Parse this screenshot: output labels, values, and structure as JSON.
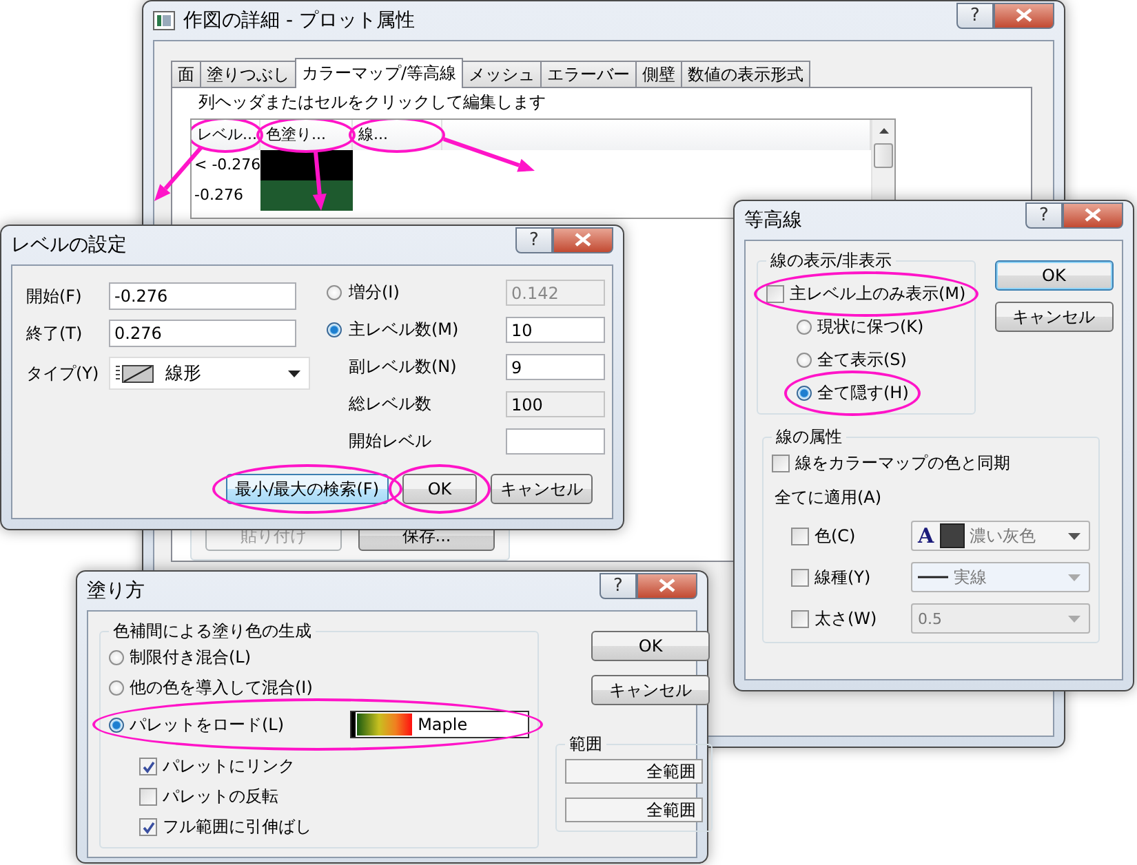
{
  "main_window": {
    "title": "作図の詳細 - プロット属性",
    "help": "?",
    "tabs": [
      {
        "label": "面",
        "selected": false
      },
      {
        "label": "塗りつぶし",
        "selected": false
      },
      {
        "label": "カラーマップ/等高線",
        "selected": true
      },
      {
        "label": "メッシュ",
        "selected": false
      },
      {
        "label": "エラーバー",
        "selected": false
      },
      {
        "label": "側壁",
        "selected": false
      },
      {
        "label": "数値の表示形式",
        "selected": false
      }
    ],
    "hint": "列ヘッダまたはセルをクリックして編集します",
    "grid": {
      "columns": [
        "レベル...",
        "色塗り...",
        "線..."
      ],
      "rows": [
        {
          "level": "< -0.276",
          "color": "#000000"
        },
        {
          "level": "-0.276",
          "color": "#1e5a2e"
        }
      ]
    },
    "buttons": [
      {
        "label": "貼り付け",
        "disabled": true
      },
      {
        "label": "保存...",
        "disabled": false
      }
    ]
  },
  "level_dialog": {
    "title": "レベルの設定",
    "help": "?",
    "fields": [
      {
        "label": "開始(F)",
        "value": "-0.276"
      },
      {
        "label": "終了(T)",
        "value": "0.276"
      }
    ],
    "type": {
      "label": "タイプ(Y)",
      "value": "線形"
    },
    "options": [
      {
        "kind": "radio",
        "label": "増分(I)",
        "selected": false,
        "value": "0.142"
      },
      {
        "kind": "radio",
        "label": "主レベル数(M)",
        "selected": true,
        "value": "10"
      },
      {
        "kind": "field",
        "label": "副レベル数(N)",
        "value": "9"
      },
      {
        "kind": "readonly",
        "label": "総レベル数",
        "value": "100"
      },
      {
        "kind": "field",
        "label": "開始レベル"
      }
    ],
    "buttons": [
      {
        "label": "最小/最大の検索(F)",
        "highlighted": true
      },
      {
        "label": "OK",
        "highlighted": false
      },
      {
        "label": "キャンセル",
        "highlighted": false
      }
    ]
  },
  "contour_dialog": {
    "title": "等高線",
    "help": "?",
    "visibility_group": "線の表示/非表示",
    "major_only": {
      "label": "主レベル上のみ表示(M)",
      "checked": false
    },
    "radios": [
      {
        "label": "現状に保つ(K)",
        "selected": false
      },
      {
        "label": "全て表示(S)",
        "selected": false
      },
      {
        "label": "全て隠す(H)",
        "selected": true
      }
    ],
    "buttons": [
      "OK",
      "キャンセル"
    ],
    "attributes_group": "線の属性",
    "sync": {
      "label": "線をカラーマップの色と同期",
      "checked": false
    },
    "apply_all": "全てに適用(A)",
    "rows": [
      {
        "kind": "color",
        "label": "色(C)",
        "checked": false,
        "glyph": "A",
        "color": "#404040",
        "value": "濃い灰色"
      },
      {
        "kind": "line",
        "label": "線種(Y)",
        "checked": false,
        "value": "実線"
      },
      {
        "kind": "plain",
        "label": "太さ(W)",
        "checked": false,
        "value": "0.5"
      }
    ]
  },
  "fill_dialog": {
    "title": "塗り方",
    "help": "?",
    "group": "色補間による塗り色の生成",
    "radios": [
      {
        "label": "制限付き混合(L)",
        "selected": false
      },
      {
        "label": "他の色を導入して混合(I)",
        "selected": false
      },
      {
        "label": "パレットをロード(L)",
        "selected": true,
        "palette": "Maple"
      }
    ],
    "checkboxes": [
      {
        "label": "パレットにリンク",
        "checked": true
      },
      {
        "label": "パレットの反転",
        "checked": false
      },
      {
        "label": "フル範囲に引伸ばし",
        "checked": true
      }
    ],
    "buttons": [
      "OK",
      "キャンセル"
    ],
    "range_group": "範囲",
    "range_fields": [
      "全範囲",
      "全範囲"
    ]
  }
}
